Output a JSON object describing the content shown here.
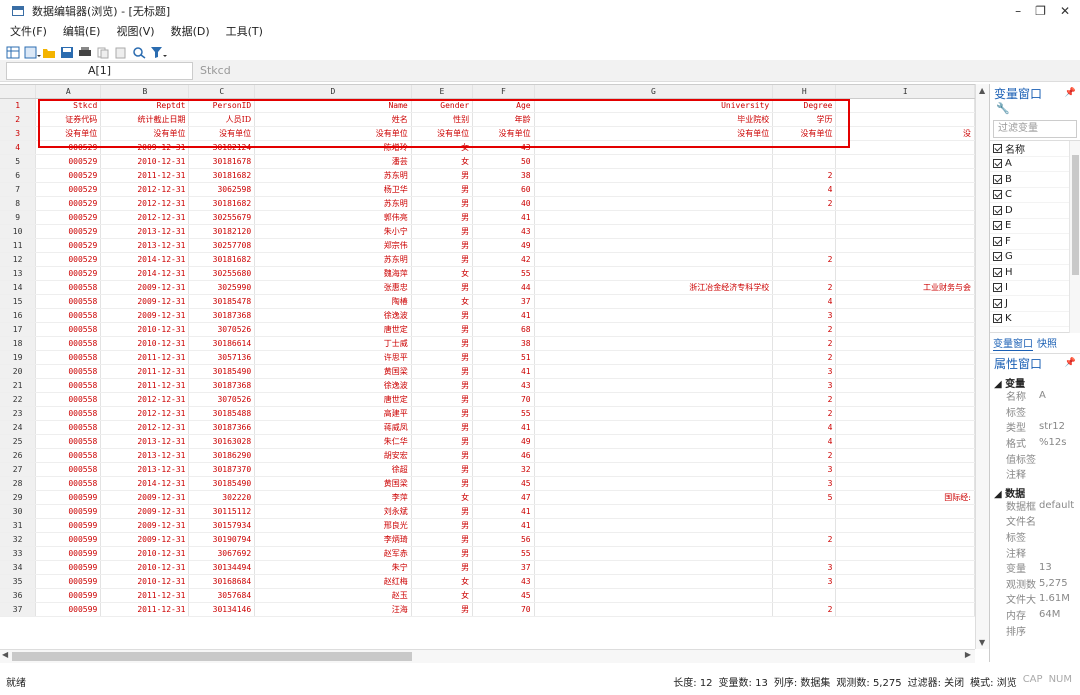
{
  "window": {
    "title": "数据编辑器(浏览) - [无标题]"
  },
  "menu": [
    "文件(F)",
    "编辑(E)",
    "视图(V)",
    "数据(D)",
    "工具(T)"
  ],
  "cell": {
    "ref": "A[1]",
    "value": "Stkcd"
  },
  "columns": [
    "A",
    "B",
    "C",
    "D",
    "E",
    "F",
    "G",
    "H",
    "I"
  ],
  "rows": [
    [
      "1",
      "Stkcd",
      "Reptdt",
      "PersonID",
      "Name",
      "Gender",
      "Age",
      "University",
      "Degree",
      ""
    ],
    [
      "2",
      "证券代码",
      "统计截止日期",
      "人员ID",
      "姓名",
      "性别",
      "年龄",
      "毕业院校",
      "学历",
      ""
    ],
    [
      "3",
      "没有单位",
      "没有单位",
      "没有单位",
      "没有单位",
      "没有单位",
      "没有单位",
      "没有单位",
      "没有单位",
      "没"
    ],
    [
      "4",
      "000529",
      "2009-12-31",
      "30182124",
      "陈增玲",
      "女",
      "43",
      "",
      "",
      ""
    ],
    [
      "5",
      "000529",
      "2010-12-31",
      "30181678",
      "潘芸",
      "女",
      "50",
      "",
      "",
      ""
    ],
    [
      "6",
      "000529",
      "2011-12-31",
      "30181682",
      "苏东明",
      "男",
      "38",
      "",
      "2",
      ""
    ],
    [
      "7",
      "000529",
      "2012-12-31",
      "3062598",
      "杨卫华",
      "男",
      "60",
      "",
      "4",
      ""
    ],
    [
      "8",
      "000529",
      "2012-12-31",
      "30181682",
      "苏东明",
      "男",
      "40",
      "",
      "2",
      ""
    ],
    [
      "9",
      "000529",
      "2012-12-31",
      "30255679",
      "郭伟亮",
      "男",
      "41",
      "",
      "",
      ""
    ],
    [
      "10",
      "000529",
      "2013-12-31",
      "30182120",
      "朱小宁",
      "男",
      "43",
      "",
      "",
      ""
    ],
    [
      "11",
      "000529",
      "2013-12-31",
      "30257708",
      "郑宗伟",
      "男",
      "49",
      "",
      "",
      ""
    ],
    [
      "12",
      "000529",
      "2014-12-31",
      "30181682",
      "苏东明",
      "男",
      "42",
      "",
      "2",
      ""
    ],
    [
      "13",
      "000529",
      "2014-12-31",
      "30255680",
      "魏海萍",
      "女",
      "55",
      "",
      "",
      ""
    ],
    [
      "14",
      "000558",
      "2009-12-31",
      "3025990",
      "张惠忠",
      "男",
      "44",
      "浙江冶金经济专科学校",
      "2",
      "工业财务与会"
    ],
    [
      "15",
      "000558",
      "2009-12-31",
      "30185478",
      "陶椿",
      "女",
      "37",
      "",
      "4",
      ""
    ],
    [
      "16",
      "000558",
      "2009-12-31",
      "30187368",
      "徐逸波",
      "男",
      "41",
      "",
      "3",
      ""
    ],
    [
      "17",
      "000558",
      "2010-12-31",
      "3070526",
      "唐世定",
      "男",
      "68",
      "",
      "2",
      ""
    ],
    [
      "18",
      "000558",
      "2010-12-31",
      "30186614",
      "丁士威",
      "男",
      "38",
      "",
      "2",
      ""
    ],
    [
      "19",
      "000558",
      "2011-12-31",
      "3057136",
      "许思平",
      "男",
      "51",
      "",
      "2",
      ""
    ],
    [
      "20",
      "000558",
      "2011-12-31",
      "30185490",
      "黄国梁",
      "男",
      "41",
      "",
      "3",
      ""
    ],
    [
      "21",
      "000558",
      "2011-12-31",
      "30187368",
      "徐逸波",
      "男",
      "43",
      "",
      "3",
      ""
    ],
    [
      "22",
      "000558",
      "2012-12-31",
      "3070526",
      "唐世定",
      "男",
      "70",
      "",
      "2",
      ""
    ],
    [
      "23",
      "000558",
      "2012-12-31",
      "30185488",
      "高建平",
      "男",
      "55",
      "",
      "2",
      ""
    ],
    [
      "24",
      "000558",
      "2012-12-31",
      "30187366",
      "蒋威凤",
      "男",
      "41",
      "",
      "4",
      ""
    ],
    [
      "25",
      "000558",
      "2013-12-31",
      "30163028",
      "朱仁华",
      "男",
      "49",
      "",
      "4",
      ""
    ],
    [
      "26",
      "000558",
      "2013-12-31",
      "30186290",
      "胡安宏",
      "男",
      "46",
      "",
      "2",
      ""
    ],
    [
      "27",
      "000558",
      "2013-12-31",
      "30187370",
      "徐超",
      "男",
      "32",
      "",
      "3",
      ""
    ],
    [
      "28",
      "000558",
      "2014-12-31",
      "30185490",
      "黄国梁",
      "男",
      "45",
      "",
      "3",
      ""
    ],
    [
      "29",
      "000599",
      "2009-12-31",
      "302220",
      "李萍",
      "女",
      "47",
      "",
      "5",
      "国际经:"
    ],
    [
      "30",
      "000599",
      "2009-12-31",
      "30115112",
      "刘永斌",
      "男",
      "41",
      "",
      "",
      ""
    ],
    [
      "31",
      "000599",
      "2009-12-31",
      "30157934",
      "邢良光",
      "男",
      "41",
      "",
      "",
      ""
    ],
    [
      "32",
      "000599",
      "2009-12-31",
      "30190794",
      "李炳琦",
      "男",
      "56",
      "",
      "2",
      ""
    ],
    [
      "33",
      "000599",
      "2010-12-31",
      "3067692",
      "赵军赤",
      "男",
      "55",
      "",
      "",
      ""
    ],
    [
      "34",
      "000599",
      "2010-12-31",
      "30134494",
      "朱宁",
      "男",
      "37",
      "",
      "3",
      ""
    ],
    [
      "35",
      "000599",
      "2010-12-31",
      "30168684",
      "赵红梅",
      "女",
      "43",
      "",
      "3",
      ""
    ],
    [
      "36",
      "000599",
      "2011-12-31",
      "3057684",
      "赵玉",
      "女",
      "45",
      "",
      "",
      ""
    ],
    [
      "37",
      "000599",
      "2011-12-31",
      "30134146",
      "汪海",
      "男",
      "70",
      "",
      "2",
      ""
    ]
  ],
  "var_panel": {
    "title": "变量窗口",
    "filter_placeholder": "过滤变量",
    "header": "名称",
    "vars": [
      "A",
      "B",
      "C",
      "D",
      "E",
      "F",
      "G",
      "H",
      "I",
      "J",
      "K"
    ],
    "tab_active": "变量窗口",
    "tab_other": "快照"
  },
  "prop_panel": {
    "title": "属性窗口",
    "sec_var": "变量",
    "var_props": [
      [
        "名称",
        "A"
      ],
      [
        "标签",
        ""
      ],
      [
        "类型",
        "str12"
      ],
      [
        "格式",
        "%12s"
      ],
      [
        "值标签",
        ""
      ],
      [
        "注释",
        ""
      ]
    ],
    "sec_data": "数据",
    "data_props": [
      [
        "数据框",
        "default"
      ],
      [
        "文件名",
        ""
      ],
      [
        "标签",
        ""
      ],
      [
        "注释",
        ""
      ],
      [
        "变量",
        "13"
      ],
      [
        "观测数",
        "5,275"
      ],
      [
        "文件大",
        "1.61M"
      ],
      [
        "内存",
        "64M"
      ],
      [
        "排序",
        ""
      ]
    ]
  },
  "status": {
    "ready": "就绪",
    "info": [
      "长度: 12",
      "变量数: 13",
      "列序: 数据集",
      "观测数: 5,275",
      "过滤器: 关闭",
      "模式: 浏览"
    ],
    "cap": "CAP",
    "num": "NUM"
  }
}
